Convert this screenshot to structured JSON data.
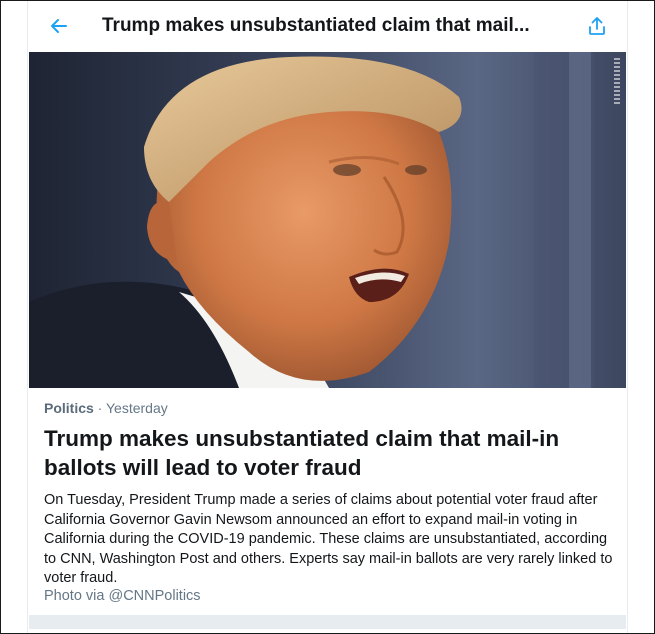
{
  "header": {
    "title": "Trump makes unsubstantiated claim that mail..."
  },
  "article": {
    "image_alt": "Photo of Donald Trump speaking",
    "category": "Politics",
    "separator": " · ",
    "time": "Yesterday",
    "headline": "Trump makes unsubstantiated claim that mail-in ballots will lead to voter fraud",
    "summary": "On Tuesday, President Trump made a series of claims about potential voter fraud after California Governor Gavin Newsom announced an effort to expand mail-in voting in California during the COVID-19 pandemic. These claims are unsubstantiated, according to CNN, Washington Post and others. Experts say mail-in ballots are very rarely linked to voter fraud.",
    "credit": "Photo via @CNNPolitics"
  },
  "icons": {
    "back": "arrow-left-icon",
    "share": "share-upload-icon"
  },
  "colors": {
    "accent": "#1da1f2",
    "text": "#14171a",
    "muted": "#657786",
    "divider": "#e6ecf0"
  }
}
